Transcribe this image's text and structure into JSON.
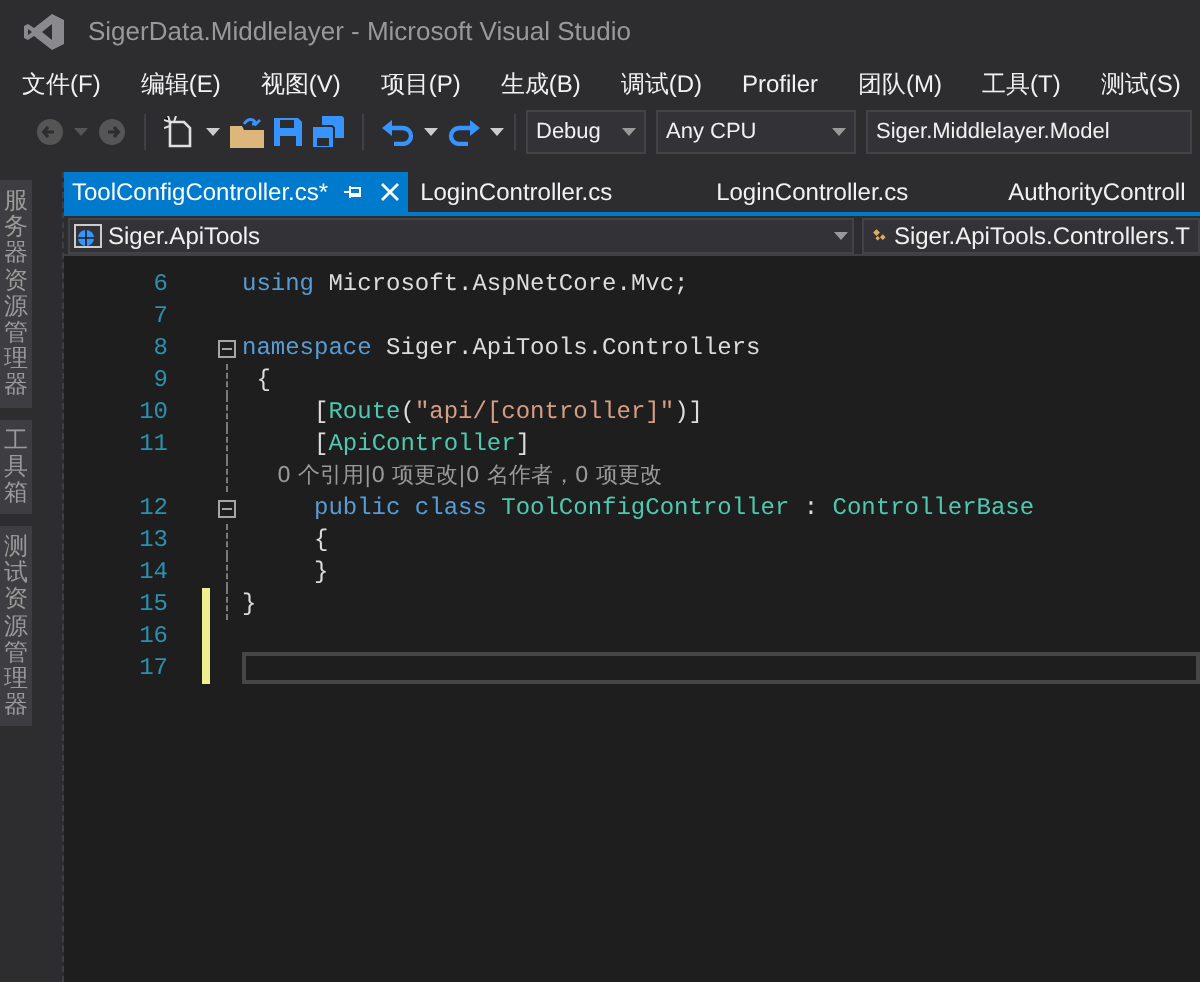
{
  "window": {
    "title": "SigerData.Middlelayer - Microsoft Visual Studio"
  },
  "menu": [
    "文件(F)",
    "编辑(E)",
    "视图(V)",
    "项目(P)",
    "生成(B)",
    "调试(D)",
    "Profiler",
    "团队(M)",
    "工具(T)",
    "测试(S)"
  ],
  "toolbar": {
    "configuration": "Debug",
    "platform": "Any CPU",
    "startup_project": "Siger.Middlelayer.Model"
  },
  "side_tabs": [
    {
      "label": "服务器资源管理器"
    },
    {
      "label": "工具箱"
    },
    {
      "label": "测试资源管理器"
    }
  ],
  "tabs": [
    {
      "label": "ToolConfigController.cs*",
      "selected": true
    },
    {
      "label": "LoginController.cs",
      "selected": false
    },
    {
      "label": "LoginController.cs",
      "selected": false
    },
    {
      "label": "AuthorityControll",
      "selected": false
    }
  ],
  "navigation": {
    "project": "Siger.ApiTools",
    "type": "Siger.ApiTools.Controllers.T"
  },
  "code_lines": [
    {
      "number": "6",
      "tokens": [
        {
          "kind": "keyword",
          "text": "using"
        },
        {
          "kind": "plain",
          "text": " Microsoft.AspNetCore.Mvc;"
        }
      ]
    },
    {
      "number": "7"
    },
    {
      "number": "8",
      "collapsible": true,
      "tokens": [
        {
          "kind": "keyword",
          "text": "namespace"
        },
        {
          "kind": "plain",
          "text": " Siger.ApiTools.Controllers"
        }
      ]
    },
    {
      "number": "9",
      "tokens": [
        {
          "kind": "plain",
          "text": " {"
        }
      ]
    },
    {
      "number": "10",
      "tokens": [
        {
          "kind": "plain",
          "text": "     ["
        },
        {
          "kind": "type",
          "text": "Route"
        },
        {
          "kind": "plain",
          "text": "("
        },
        {
          "kind": "string",
          "text": "\"api/[controller]\""
        },
        {
          "kind": "plain",
          "text": ")]"
        }
      ]
    },
    {
      "number": "11",
      "tokens": [
        {
          "kind": "plain",
          "text": "     ["
        },
        {
          "kind": "type",
          "text": "ApiController"
        },
        {
          "kind": "plain",
          "text": "]"
        }
      ]
    },
    {
      "tokens": [
        {
          "kind": "codelens",
          "text": "     0 个引用|0 项更改|0 名作者，0 项更改"
        }
      ]
    },
    {
      "number": "12",
      "collapsible": true,
      "tokens": [
        {
          "kind": "keyword",
          "text": "     public class"
        },
        {
          "kind": "type",
          "text": " ToolConfigController"
        },
        {
          "kind": "plain",
          "text": " : "
        },
        {
          "kind": "type",
          "text": "ControllerBase"
        }
      ]
    },
    {
      "number": "13",
      "tokens": [
        {
          "kind": "plain",
          "text": "     {"
        }
      ]
    },
    {
      "number": "14",
      "tokens": [
        {
          "kind": "plain",
          "text": "     }"
        }
      ]
    },
    {
      "number": "15",
      "changed": true,
      "tokens": [
        {
          "kind": "plain",
          "text": "}"
        }
      ]
    },
    {
      "number": "16",
      "changed": true
    },
    {
      "number": "17",
      "changed": true,
      "current": true
    }
  ]
}
